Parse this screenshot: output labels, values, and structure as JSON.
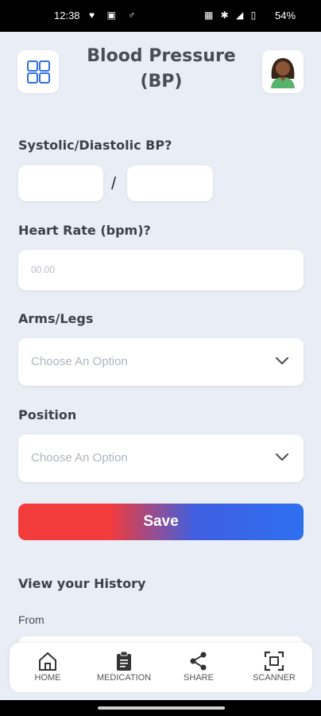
{
  "status_bar": {
    "time": "12:38",
    "left_icons": "♥ ▣ ♂",
    "right_icons": "▦ ✱ ◢ ▯",
    "battery": "54%"
  },
  "header": {
    "title_line1": "Blood Pressure",
    "title_line2": "(BP)",
    "menu_icon": "grid-icon",
    "avatar_icon": "avatar"
  },
  "form": {
    "bp_label": "Systolic/Diastolic BP?",
    "separator": "/",
    "heart_rate_label": "Heart Rate (bpm)?",
    "heart_rate_placeholder": "00.00",
    "arms_legs_label": "Arms/Legs",
    "arms_legs_value": "Choose An Option",
    "position_label": "Position",
    "position_value": "Choose An Option",
    "save_label": "Save"
  },
  "history": {
    "title": "View your History",
    "from_label": "From"
  },
  "nav": {
    "items": [
      {
        "label": "HOME",
        "icon": "home-icon"
      },
      {
        "label": "MEDICATION",
        "icon": "clipboard-icon"
      },
      {
        "label": "SHARE",
        "icon": "share-icon"
      },
      {
        "label": "SCANNER",
        "icon": "scanner-icon"
      }
    ]
  },
  "colors": {
    "background": "#e9edf5",
    "accent_blue": "#2e6ff0",
    "accent_red": "#f23b3b"
  }
}
